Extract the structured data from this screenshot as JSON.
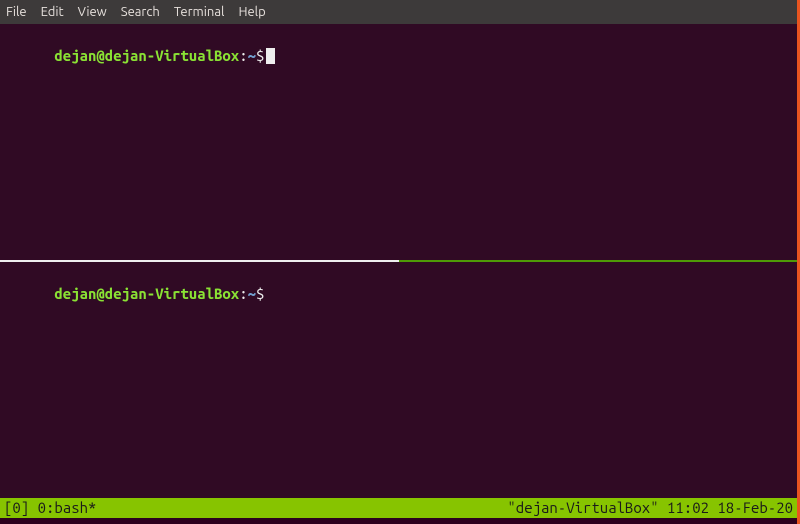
{
  "menubar": {
    "items": [
      "File",
      "Edit",
      "View",
      "Search",
      "Terminal",
      "Help"
    ]
  },
  "panes": {
    "top": {
      "user_host": "dejan@dejan-VirtualBox",
      "path": "~",
      "dollar": "$"
    },
    "bottom": {
      "user_host": "dejan@dejan-VirtualBox",
      "path": "~",
      "dollar": "$"
    }
  },
  "statusbar": {
    "left": "[0] 0:bash*",
    "right": "\"dejan-VirtualBox\" 11:02 18-Feb-20"
  }
}
